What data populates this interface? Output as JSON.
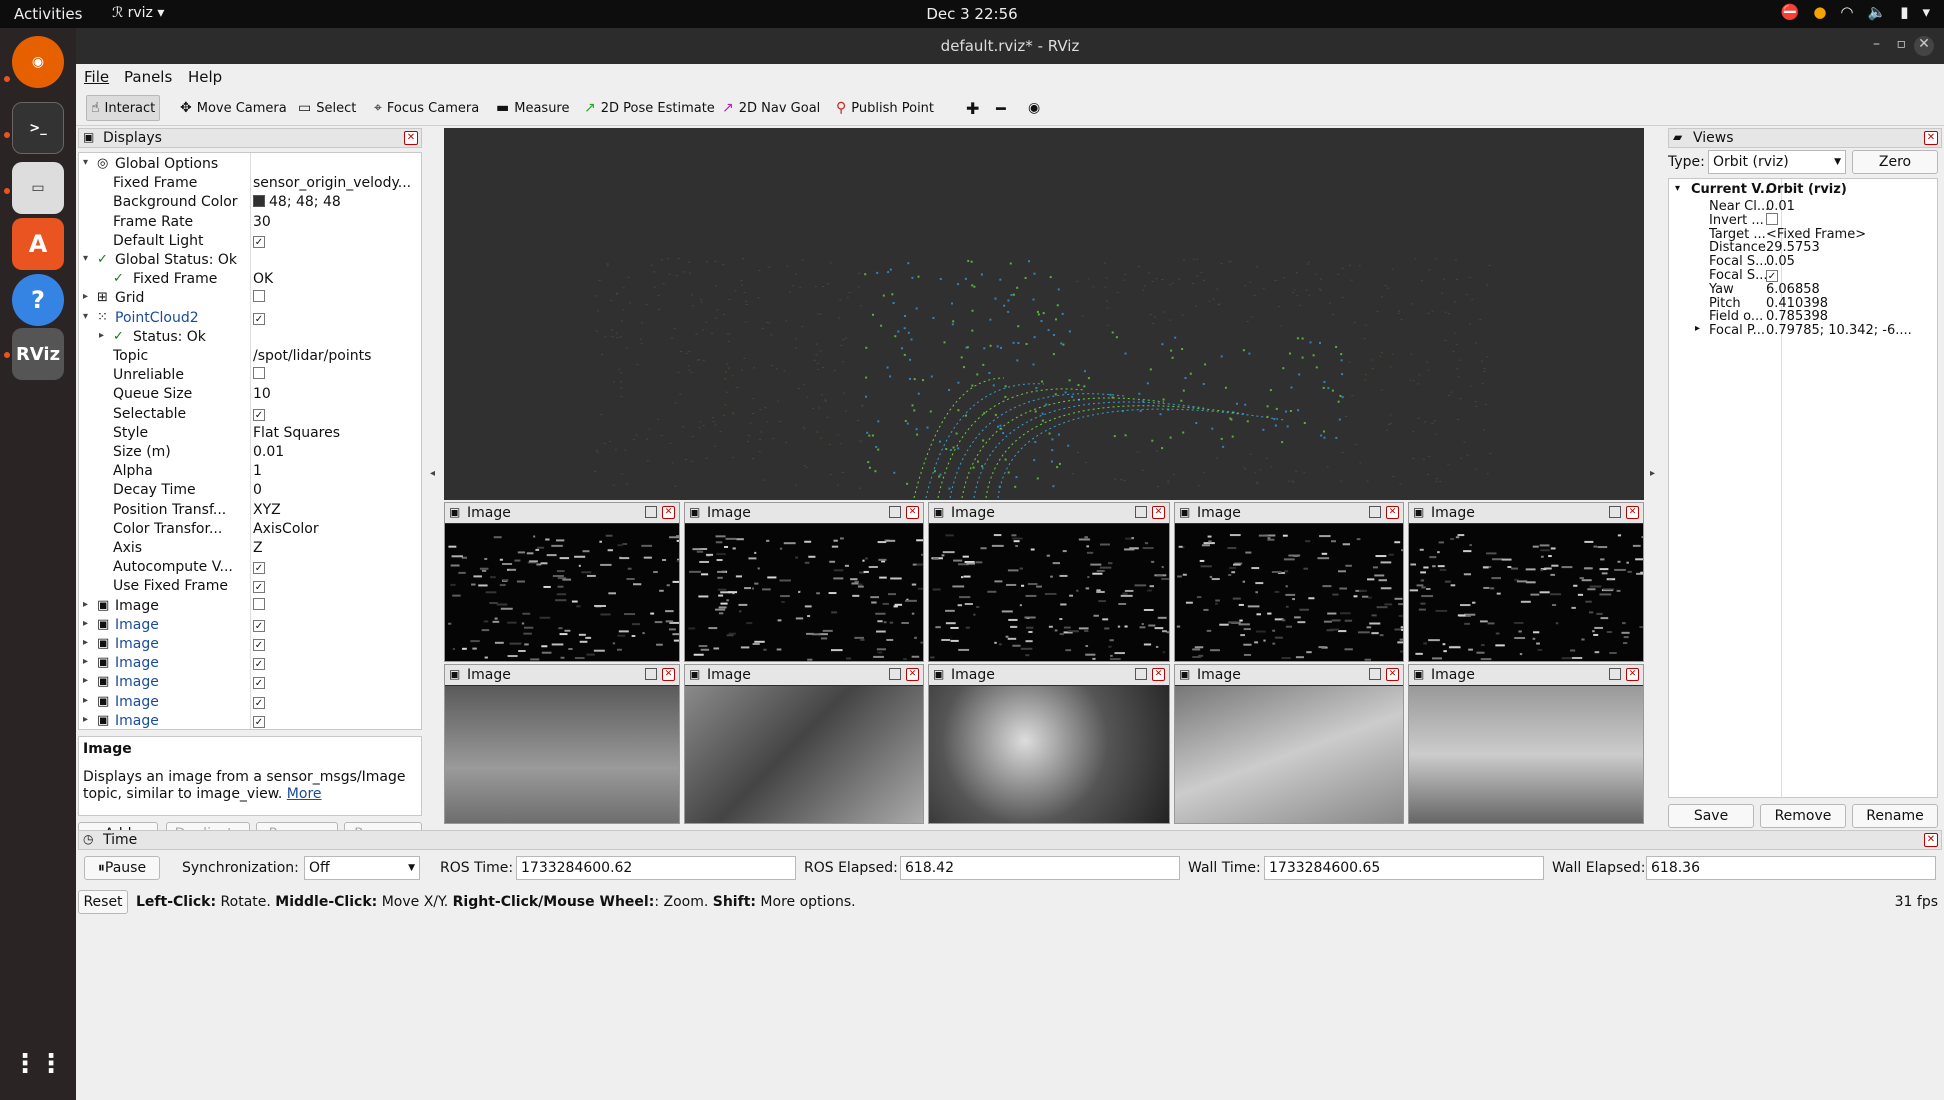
{
  "topbar": {
    "activities": "Activities",
    "app": "rviz",
    "clock": "Dec 3  22:56"
  },
  "window": {
    "title": "default.rviz* - RViz",
    "minimize": "–",
    "maximize": "▫",
    "close": "✕"
  },
  "menu": {
    "file": "File",
    "panels": "Panels",
    "help": "Help"
  },
  "toolbar": {
    "interact": "Interact",
    "move_camera": "Move Camera",
    "select": "Select",
    "focus_camera": "Focus Camera",
    "measure": "Measure",
    "pose_estimate": "2D Pose Estimate",
    "nav_goal": "2D Nav Goal",
    "publish_point": "Publish Point"
  },
  "displays": {
    "title": "Displays",
    "rows": [
      {
        "k": "Global Options",
        "v": "",
        "d": 0,
        "arrow": "▾",
        "icon": "◎",
        "color": ""
      },
      {
        "k": "Fixed Frame",
        "v": "sensor_origin_velody...",
        "d": 1
      },
      {
        "k": "Background Color",
        "v": "48; 48; 48",
        "d": 1,
        "swatch": true
      },
      {
        "k": "Frame Rate",
        "v": "30",
        "d": 1
      },
      {
        "k": "Default Light",
        "v": "",
        "d": 1,
        "check": "✓"
      },
      {
        "k": "Global Status: Ok",
        "v": "",
        "d": 0,
        "arrow": "▾",
        "icon": "✓",
        "color": ""
      },
      {
        "k": "Fixed Frame",
        "v": "OK",
        "d": 1,
        "icon": "✓"
      },
      {
        "k": "Grid",
        "v": "",
        "d": 0,
        "arrow": "▸",
        "icon": "⊞",
        "check": ""
      },
      {
        "k": "PointCloud2",
        "v": "",
        "d": 0,
        "arrow": "▾",
        "icon": "⁙",
        "check": "✓",
        "color": "blue"
      },
      {
        "k": "Status: Ok",
        "v": "",
        "d": 1,
        "arrow": "▸",
        "icon": "✓"
      },
      {
        "k": "Topic",
        "v": "/spot/lidar/points",
        "d": 1
      },
      {
        "k": "Unreliable",
        "v": "",
        "d": 1,
        "check": ""
      },
      {
        "k": "Queue Size",
        "v": "10",
        "d": 1
      },
      {
        "k": "Selectable",
        "v": "",
        "d": 1,
        "check": "✓"
      },
      {
        "k": "Style",
        "v": "Flat Squares",
        "d": 1
      },
      {
        "k": "Size (m)",
        "v": "0.01",
        "d": 1
      },
      {
        "k": "Alpha",
        "v": "1",
        "d": 1
      },
      {
        "k": "Decay Time",
        "v": "0",
        "d": 1
      },
      {
        "k": "Position Transf...",
        "v": "XYZ",
        "d": 1
      },
      {
        "k": "Color Transfor...",
        "v": "AxisColor",
        "d": 1
      },
      {
        "k": "Axis",
        "v": "Z",
        "d": 1
      },
      {
        "k": "Autocompute V...",
        "v": "",
        "d": 1,
        "check": "✓"
      },
      {
        "k": "Use Fixed Frame",
        "v": "",
        "d": 1,
        "check": "✓"
      },
      {
        "k": "Image",
        "v": "",
        "d": 0,
        "arrow": "▸",
        "icon": "▣",
        "check": ""
      },
      {
        "k": "Image",
        "v": "",
        "d": 0,
        "arrow": "▸",
        "icon": "▣",
        "check": "✓",
        "color": "blue"
      },
      {
        "k": "Image",
        "v": "",
        "d": 0,
        "arrow": "▸",
        "icon": "▣",
        "check": "✓",
        "color": "blue"
      },
      {
        "k": "Image",
        "v": "",
        "d": 0,
        "arrow": "▸",
        "icon": "▣",
        "check": "✓",
        "color": "blue"
      },
      {
        "k": "Image",
        "v": "",
        "d": 0,
        "arrow": "▸",
        "icon": "▣",
        "check": "✓",
        "color": "blue"
      },
      {
        "k": "Image",
        "v": "",
        "d": 0,
        "arrow": "▸",
        "icon": "▣",
        "check": "✓",
        "color": "blue"
      },
      {
        "k": "Image",
        "v": "",
        "d": 0,
        "arrow": "▸",
        "icon": "▣",
        "check": "✓",
        "color": "blue"
      },
      {
        "k": "Image",
        "v": "",
        "d": 0,
        "arrow": "▸",
        "icon": "▣",
        "check": "✓",
        "color": "blue"
      },
      {
        "k": "Image",
        "v": "",
        "d": 0,
        "arrow": "▸",
        "icon": "▣",
        "check": "✓",
        "color": "blue"
      },
      {
        "k": "Image",
        "v": "",
        "d": 0,
        "arrow": "▸",
        "icon": "▣",
        "check": "✓",
        "color": "blue"
      },
      {
        "k": "Image",
        "v": "",
        "d": 0,
        "arrow": "▸",
        "icon": "▣",
        "check": "✓",
        "color": "blue"
      }
    ],
    "desc_title": "Image",
    "desc_text": "Displays an image from a sensor_msgs/Image topic, similar to image_view.",
    "desc_link": "More",
    "buttons": {
      "add": "Add",
      "duplicate": "Duplicate",
      "remove": "Remove",
      "rename": "Rename"
    }
  },
  "image_panels": {
    "label": "Image"
  },
  "views": {
    "title": "Views",
    "type_label": "Type:",
    "type_value": "Orbit (rviz)",
    "zero": "Zero",
    "header_k": "Current V...",
    "header_v": "Orbit (rviz)",
    "rows": [
      {
        "k": "Near Cl...",
        "v": "0.01"
      },
      {
        "k": "Invert ...",
        "v": "",
        "check": ""
      },
      {
        "k": "Target ...",
        "v": "<Fixed Frame>"
      },
      {
        "k": "Distance",
        "v": "29.5753"
      },
      {
        "k": "Focal S...",
        "v": "0.05"
      },
      {
        "k": "Focal S...",
        "v": "",
        "check": "✓"
      },
      {
        "k": "Yaw",
        "v": "6.06858"
      },
      {
        "k": "Pitch",
        "v": "0.410398"
      },
      {
        "k": "Field o...",
        "v": "0.785398"
      },
      {
        "k": "Focal P...",
        "v": "0.79785; 10.342; -6....",
        "arrow": "▸"
      }
    ],
    "buttons": {
      "save": "Save",
      "remove": "Remove",
      "rename": "Rename"
    }
  },
  "time": {
    "title": "Time",
    "pause": "Pause",
    "sync_label": "Synchronization:",
    "sync_value": "Off",
    "ros_time_label": "ROS Time:",
    "ros_time": "1733284600.62",
    "ros_elapsed_label": "ROS Elapsed:",
    "ros_elapsed": "618.42",
    "wall_time_label": "Wall Time:",
    "wall_time": "1733284600.65",
    "wall_elapsed_label": "Wall Elapsed:",
    "wall_elapsed": "618.36"
  },
  "status": {
    "reset": "Reset",
    "b1": "Left-Click:",
    "t1": " Rotate. ",
    "b2": "Middle-Click:",
    "t2": " Move X/Y. ",
    "b3": "Right-Click/Mouse Wheel:",
    "t3": ": Zoom. ",
    "b4": "Shift:",
    "t4": " More options.",
    "fps": "31 fps"
  },
  "colors": {
    "background": "#303030",
    "accent": "#e9541f",
    "link": "#1a4c9a"
  }
}
